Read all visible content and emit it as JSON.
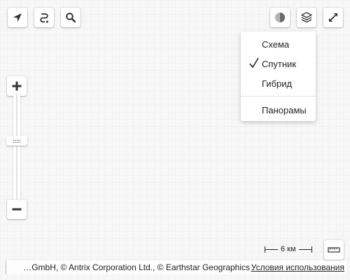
{
  "toolbar_left": {
    "route_icon": "navigation-arrow-icon",
    "routes_icon": "route-icon",
    "search_icon": "search-icon"
  },
  "toolbar_right": {
    "traffic_icon": "traffic-icon",
    "layers_icon": "layers-icon",
    "fullscreen_icon": "expand-icon"
  },
  "layers_menu": {
    "items": [
      {
        "label": "Схема",
        "checked": false
      },
      {
        "label": "Спутник",
        "checked": true
      },
      {
        "label": "Гибрид",
        "checked": false
      }
    ],
    "extra": {
      "label": "Панорамы"
    }
  },
  "zoom": {
    "in_icon": "plus-icon",
    "out_icon": "minus-icon",
    "level_fraction": 0.43
  },
  "scale": {
    "label": "6 км"
  },
  "ruler_icon": "ruler-icon",
  "copyright": {
    "text": "…GmbH, © Antrix Corporation Ltd., © Earthstar Geographics",
    "terms_label": "Условия использования"
  }
}
